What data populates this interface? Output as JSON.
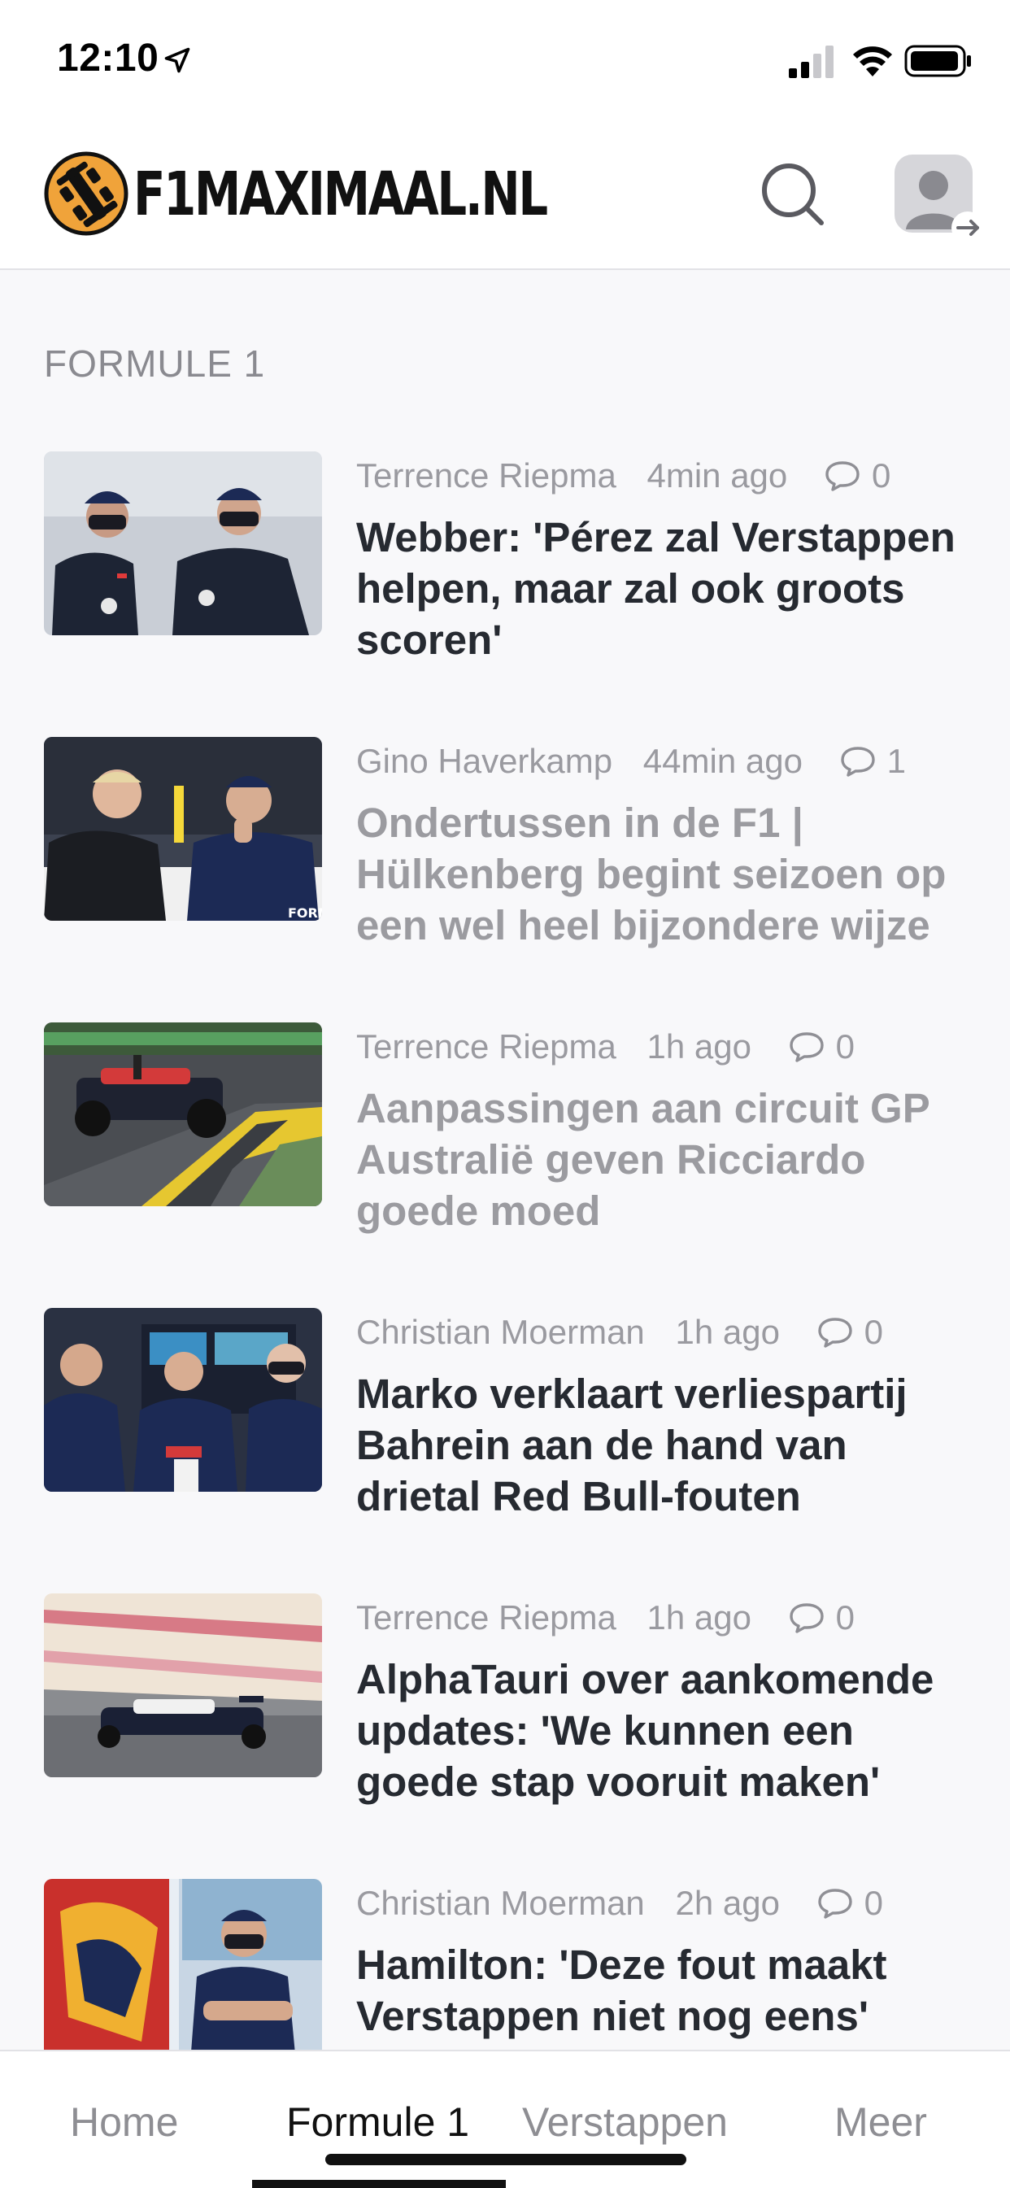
{
  "status_bar": {
    "time": "12:10"
  },
  "header": {
    "logo_text": "F1MAXIMAAL.NL"
  },
  "section_title": "FORMULE 1",
  "articles": [
    {
      "author": "Terrence Riepma",
      "time": "4min ago",
      "comments": "0",
      "title": "Webber: 'Pérez zal Verstappen helpen, maar zal ook groots scoren'",
      "read": false
    },
    {
      "author": "Gino Haverkamp",
      "time": "44min ago",
      "comments": "1",
      "title": "Ondertussen in de F1 | Hülkenberg begint seizoen op een wel heel bijzondere wijze",
      "read": true
    },
    {
      "author": "Terrence Riepma",
      "time": "1h ago",
      "comments": "0",
      "title": "Aanpassingen aan circuit GP Australië geven Ricciardo goede moed",
      "read": true
    },
    {
      "author": "Christian Moerman",
      "time": "1h ago",
      "comments": "0",
      "title": "Marko verklaart verliespartij Bahrein aan de hand van drietal Red Bull-fouten",
      "read": false
    },
    {
      "author": "Terrence Riepma",
      "time": "1h ago",
      "comments": "0",
      "title": "AlphaTauri over aankomende updates: 'We kunnen een goede stap vooruit maken'",
      "read": false
    },
    {
      "author": "Christian Moerman",
      "time": "2h ago",
      "comments": "0",
      "title": "Hamilton: 'Deze fout maakt Verstappen niet nog eens'",
      "read": false
    }
  ],
  "tabs": [
    {
      "label": "Home",
      "active": false
    },
    {
      "label": "Formule 1",
      "active": true
    },
    {
      "label": "Verstappen",
      "active": false
    },
    {
      "label": "Meer",
      "active": false
    }
  ],
  "colors": {
    "background": "#f8f8fa",
    "headline": "#262a31",
    "headline_read": "#9b9ba0",
    "meta": "#9a9aa0",
    "logo_orange": "#f0a33a"
  }
}
